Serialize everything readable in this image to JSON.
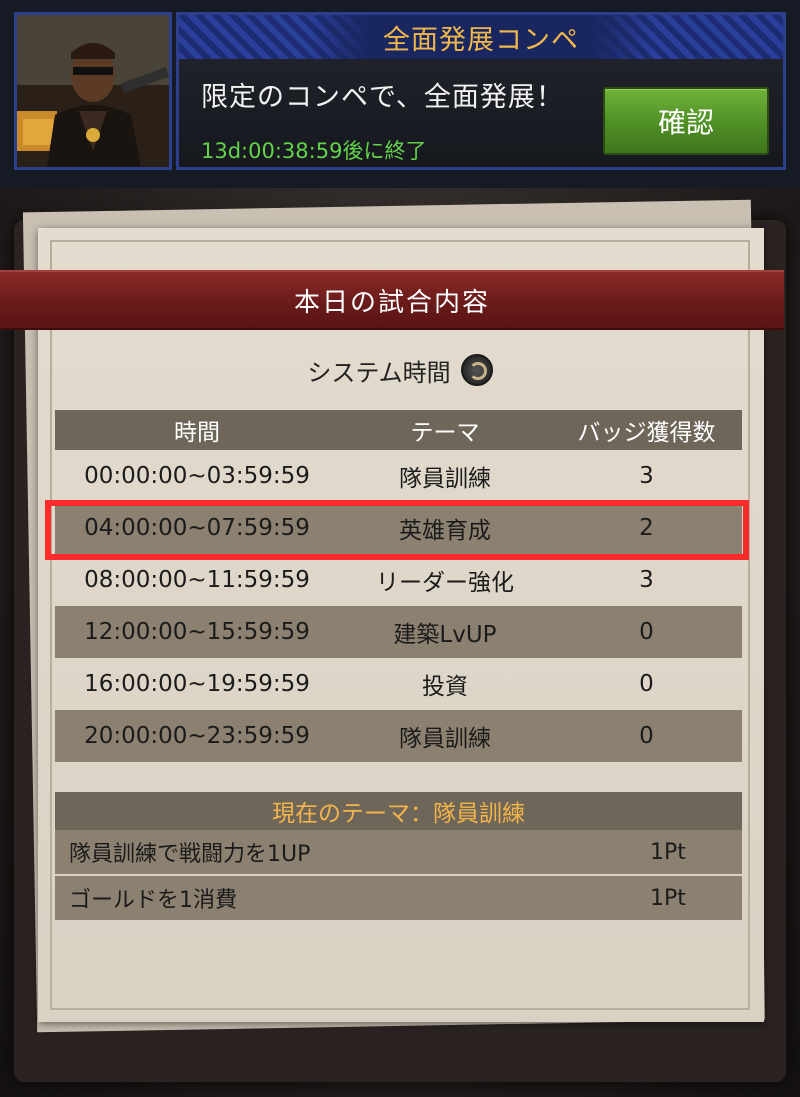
{
  "event": {
    "title": "全面発展コンペ",
    "description": "限定のコンペで、全面発展！",
    "countdown": "13d:00:38:59後に終了",
    "confirm_label": "確認"
  },
  "schedule": {
    "header_title": "本日の試合内容",
    "system_time_label": "システム時間",
    "columns": [
      "時間",
      "テーマ",
      "バッジ獲得数"
    ],
    "rows": [
      {
        "time": "00:00:00~03:59:59",
        "theme": "隊員訓練",
        "badges": "3"
      },
      {
        "time": "04:00:00~07:59:59",
        "theme": "英雄育成",
        "badges": "2"
      },
      {
        "time": "08:00:00~11:59:59",
        "theme": "リーダー強化",
        "badges": "3"
      },
      {
        "time": "12:00:00~15:59:59",
        "theme": "建築LvUP",
        "badges": "0"
      },
      {
        "time": "16:00:00~19:59:59",
        "theme": "投資",
        "badges": "0"
      },
      {
        "time": "20:00:00~23:59:59",
        "theme": "隊員訓練",
        "badges": "0"
      }
    ]
  },
  "current_theme": {
    "heading": "現在のテーマ：隊員訓練",
    "tasks": [
      {
        "task": "隊員訓練で戦闘力を1UP",
        "points": "1Pt"
      },
      {
        "task": "ゴールドを1消費",
        "points": "1Pt"
      }
    ]
  },
  "colors": {
    "title_gold": "#f0b84a",
    "countdown_green": "#63d44a",
    "button_green": "#5a9c2e",
    "ribbon_red": "#6a1b1a",
    "highlight_red": "#ff2a2a"
  }
}
